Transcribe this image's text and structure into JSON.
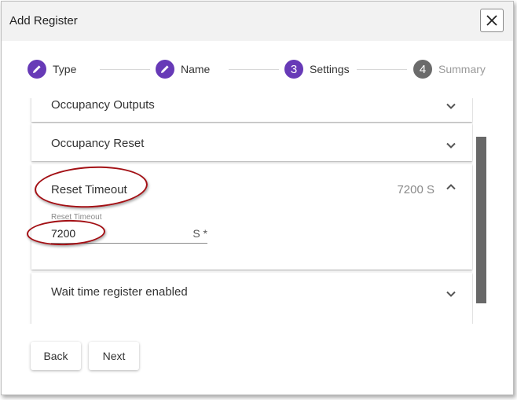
{
  "dialog": {
    "title": "Add Register"
  },
  "stepper": {
    "steps": [
      {
        "label": "Type",
        "icon": "pencil-icon",
        "state": "done"
      },
      {
        "label": "Name",
        "icon": "pencil-icon",
        "state": "done"
      },
      {
        "label": "Settings",
        "number": "3",
        "state": "active"
      },
      {
        "label": "Summary",
        "number": "4",
        "state": "inactive"
      }
    ]
  },
  "panels": {
    "occupancy_outputs": {
      "title": "Occupancy Outputs",
      "icon": "chevron-down-icon"
    },
    "occupancy_reset": {
      "title": "Occupancy Reset",
      "icon": "chevron-down-icon"
    },
    "reset_timeout": {
      "title": "Reset Timeout",
      "value": "7200 S",
      "icon": "chevron-up-icon",
      "field": {
        "label": "Reset Timeout",
        "value": "7200",
        "suffix": "S *"
      }
    },
    "wait_time": {
      "title": "Wait time register enabled",
      "icon": "chevron-down-icon"
    }
  },
  "footer": {
    "back_label": "Back",
    "next_label": "Next"
  },
  "colors": {
    "accent": "#673ab7",
    "inactive_step": "#6b6b6b",
    "annotation": "#a30f14"
  }
}
